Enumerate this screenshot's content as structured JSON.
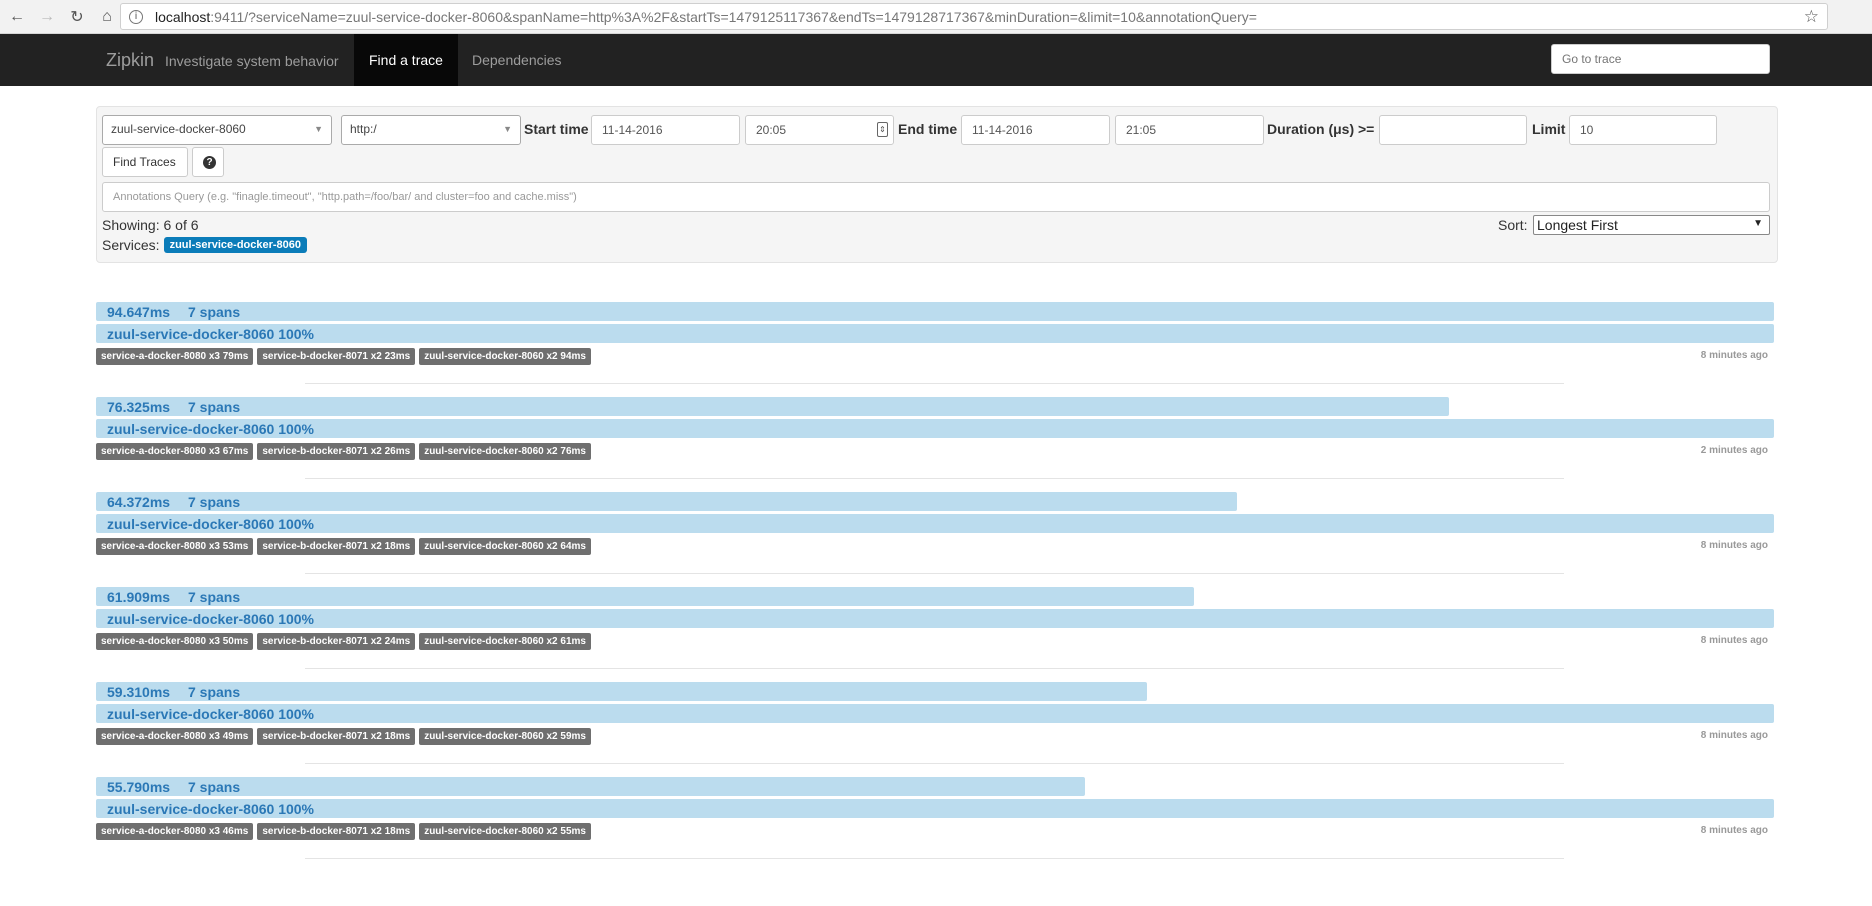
{
  "browser": {
    "url_host": "localhost",
    "url_rest": ":9411/?serviceName=zuul-service-docker-8060&spanName=http%3A%2F&startTs=1479125117367&endTs=1479128717367&minDuration=&limit=10&annotationQuery="
  },
  "navbar": {
    "brand": "Zipkin",
    "tagline": "Investigate system behavior",
    "tabs": [
      {
        "label": "Find a trace",
        "active": true
      },
      {
        "label": "Dependencies",
        "active": false
      }
    ],
    "goto_placeholder": "Go to trace"
  },
  "search": {
    "service": "zuul-service-docker-8060",
    "span": "http:/",
    "start_time_label": "Start time",
    "start_date": "11-14-2016",
    "start_time": "20:05",
    "end_time_label": "End time",
    "end_date": "11-14-2016",
    "end_time": "21:05",
    "duration_label": "Duration (μs) >=",
    "duration_value": "",
    "limit_label": "Limit",
    "limit_value": "10",
    "find_button": "Find Traces",
    "annotations_placeholder": "Annotations Query (e.g. \"finagle.timeout\", \"http.path=/foo/bar/ and cluster=foo and cache.miss\")",
    "showing": "Showing: 6 of 6",
    "services_label": "Services:",
    "service_badge": "zuul-service-docker-8060",
    "sort_label": "Sort:",
    "sort_value": "Longest First"
  },
  "traces": [
    {
      "duration": "94.647ms",
      "spans": "7 spans",
      "service": "zuul-service-docker-8060 100%",
      "width_fraction": 1.0,
      "tags": [
        "service-a-docker-8080 x3 79ms",
        "service-b-docker-8071 x2 23ms",
        "zuul-service-docker-8060 x2 94ms"
      ],
      "ago": "8 minutes ago"
    },
    {
      "duration": "76.325ms",
      "spans": "7 spans",
      "service": "zuul-service-docker-8060 100%",
      "width_fraction": 0.8064,
      "tags": [
        "service-a-docker-8080 x3 67ms",
        "service-b-docker-8071 x2 26ms",
        "zuul-service-docker-8060 x2 76ms"
      ],
      "ago": "2 minutes ago"
    },
    {
      "duration": "64.372ms",
      "spans": "7 spans",
      "service": "zuul-service-docker-8060 100%",
      "width_fraction": 0.6801,
      "tags": [
        "service-a-docker-8080 x3 53ms",
        "service-b-docker-8071 x2 18ms",
        "zuul-service-docker-8060 x2 64ms"
      ],
      "ago": "8 minutes ago"
    },
    {
      "duration": "61.909ms",
      "spans": "7 spans",
      "service": "zuul-service-docker-8060 100%",
      "width_fraction": 0.6541,
      "tags": [
        "service-a-docker-8080 x3 50ms",
        "service-b-docker-8071 x2 24ms",
        "zuul-service-docker-8060 x2 61ms"
      ],
      "ago": "8 minutes ago"
    },
    {
      "duration": "59.310ms",
      "spans": "7 spans",
      "service": "zuul-service-docker-8060 100%",
      "width_fraction": 0.6266,
      "tags": [
        "service-a-docker-8080 x3 49ms",
        "service-b-docker-8071 x2 18ms",
        "zuul-service-docker-8060 x2 59ms"
      ],
      "ago": "8 minutes ago"
    },
    {
      "duration": "55.790ms",
      "spans": "7 spans",
      "service": "zuul-service-docker-8060 100%",
      "width_fraction": 0.5895,
      "tags": [
        "service-a-docker-8080 x3 46ms",
        "service-b-docker-8071 x2 18ms",
        "zuul-service-docker-8060 x2 55ms"
      ],
      "ago": "8 minutes ago"
    }
  ],
  "colors": {
    "navbar_bg": "#222222",
    "bar_fill": "#bbdcee",
    "bar_text": "#2b78b6",
    "service_badge": "#0b7cb9",
    "tag_bg": "#6f6f6f"
  }
}
